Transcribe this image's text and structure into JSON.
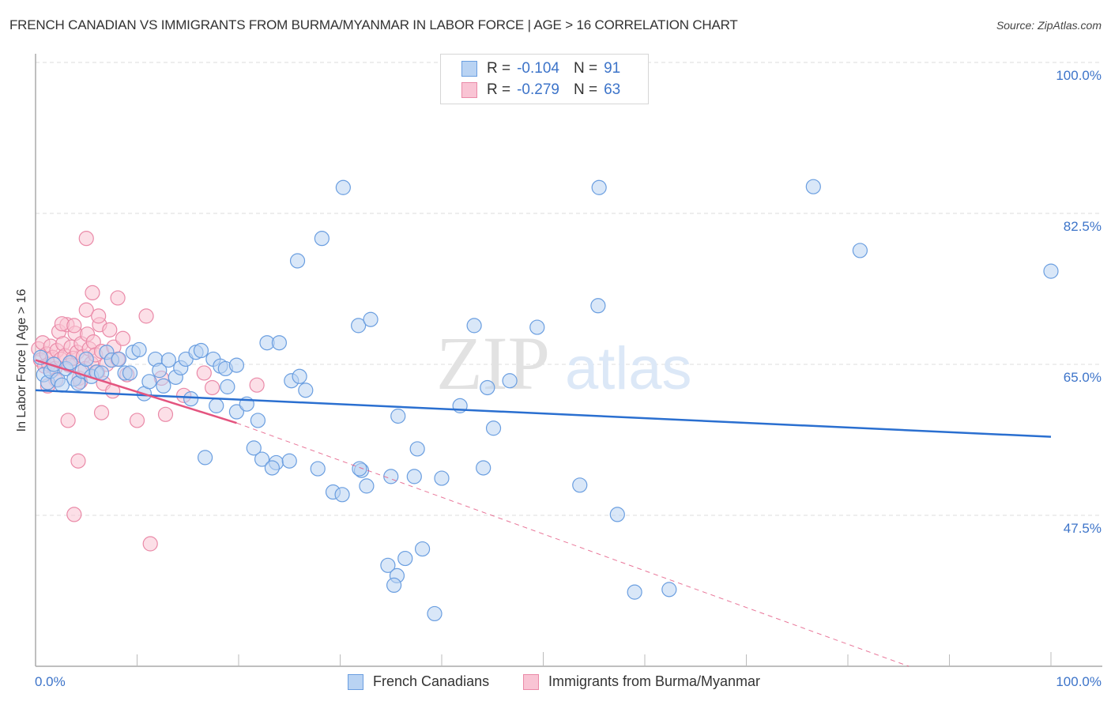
{
  "header": {
    "title": "FRENCH CANADIAN VS IMMIGRANTS FROM BURMA/MYANMAR IN LABOR FORCE | AGE > 16 CORRELATION CHART",
    "source": "Source: ZipAtlas.com"
  },
  "watermark": {
    "zip": "ZIP",
    "atlas": "atlas"
  },
  "legend": {
    "rows": [
      {
        "r_label": "R =",
        "r_value": "-0.104",
        "n_label": "N =",
        "n_value": "91"
      },
      {
        "r_label": "R =",
        "r_value": "-0.279",
        "n_label": "N =",
        "n_value": "63"
      }
    ]
  },
  "colors": {
    "blue_fill": "#b9d3f3",
    "blue_stroke": "#6a9ee0",
    "blue_line": "#2a6fd0",
    "pink_fill": "#f9c4d4",
    "pink_stroke": "#ea8aa8",
    "pink_line": "#e4547f",
    "tick_text": "#3d74c9",
    "grid": "#dddddd"
  },
  "chart_data": {
    "type": "scatter",
    "title": "FRENCH CANADIAN VS IMMIGRANTS FROM BURMA/MYANMAR IN LABOR FORCE | AGE > 16 CORRELATION CHART",
    "xlabel": "",
    "ylabel": "In Labor Force | Age > 16",
    "xlim": [
      0,
      100
    ],
    "ylim": [
      30,
      101.5
    ],
    "x_tick_labels": [
      "0.0%",
      "100.0%"
    ],
    "y_ticks": [
      100.0,
      82.5,
      65.0,
      47.5
    ],
    "y_tick_labels": [
      "100.0%",
      "82.5%",
      "65.0%",
      "47.5%"
    ],
    "grid": true,
    "legend_position": "top-center",
    "series": [
      {
        "name": "French Canadians",
        "R": -0.104,
        "N": 91,
        "trend": {
          "x": [
            0,
            100
          ],
          "y": [
            62.0,
            56.6
          ]
        },
        "points": [
          [
            0.5,
            65.8
          ],
          [
            0.8,
            63.8
          ],
          [
            1.2,
            62.9
          ],
          [
            1.5,
            64.2
          ],
          [
            1.8,
            65.0
          ],
          [
            2.2,
            63.2
          ],
          [
            2.6,
            62.6
          ],
          [
            3.0,
            64.5
          ],
          [
            3.4,
            65.2
          ],
          [
            3.8,
            63.3
          ],
          [
            4.2,
            62.8
          ],
          [
            4.6,
            64.2
          ],
          [
            5.0,
            65.6
          ],
          [
            5.5,
            63.6
          ],
          [
            6.0,
            64.1
          ],
          [
            6.5,
            64.0
          ],
          [
            7.0,
            66.4
          ],
          [
            7.5,
            65.5
          ],
          [
            8.2,
            65.6
          ],
          [
            8.8,
            64.0
          ],
          [
            9.3,
            64.0
          ],
          [
            9.6,
            66.4
          ],
          [
            10.2,
            66.7
          ],
          [
            10.7,
            61.6
          ],
          [
            11.2,
            63.0
          ],
          [
            11.8,
            65.6
          ],
          [
            12.2,
            64.3
          ],
          [
            12.6,
            62.5
          ],
          [
            13.1,
            65.5
          ],
          [
            13.8,
            63.5
          ],
          [
            14.3,
            64.6
          ],
          [
            14.8,
            65.6
          ],
          [
            15.3,
            61.0
          ],
          [
            15.8,
            66.4
          ],
          [
            16.3,
            66.6
          ],
          [
            17.5,
            65.6
          ],
          [
            18.2,
            64.8
          ],
          [
            18.7,
            64.5
          ],
          [
            18.9,
            62.4
          ],
          [
            19.8,
            64.9
          ],
          [
            17.8,
            60.2
          ],
          [
            19.8,
            59.5
          ],
          [
            20.8,
            60.4
          ],
          [
            21.9,
            58.5
          ],
          [
            16.7,
            54.2
          ],
          [
            21.5,
            55.3
          ],
          [
            22.3,
            54.0
          ],
          [
            23.7,
            53.6
          ],
          [
            23.3,
            53.0
          ],
          [
            25.0,
            53.8
          ],
          [
            22.8,
            67.5
          ],
          [
            24.0,
            67.5
          ],
          [
            25.2,
            63.1
          ],
          [
            26.0,
            63.6
          ],
          [
            26.6,
            62.0
          ],
          [
            25.8,
            77.0
          ],
          [
            28.2,
            79.6
          ],
          [
            30.3,
            85.5
          ],
          [
            31.8,
            69.5
          ],
          [
            33.0,
            70.2
          ],
          [
            27.8,
            52.9
          ],
          [
            29.3,
            50.2
          ],
          [
            30.2,
            49.9
          ],
          [
            32.1,
            52.7
          ],
          [
            31.9,
            52.9
          ],
          [
            32.6,
            50.9
          ],
          [
            35.0,
            52.0
          ],
          [
            37.3,
            52.0
          ],
          [
            40.0,
            51.8
          ],
          [
            37.6,
            55.2
          ],
          [
            35.7,
            59.0
          ],
          [
            44.1,
            53.0
          ],
          [
            45.1,
            57.6
          ],
          [
            44.5,
            62.3
          ],
          [
            46.7,
            63.1
          ],
          [
            41.8,
            60.2
          ],
          [
            43.2,
            69.5
          ],
          [
            49.4,
            69.3
          ],
          [
            53.6,
            51.0
          ],
          [
            55.4,
            71.8
          ],
          [
            55.5,
            85.5
          ],
          [
            34.7,
            41.7
          ],
          [
            35.6,
            40.5
          ],
          [
            38.1,
            43.6
          ],
          [
            36.4,
            42.5
          ],
          [
            35.3,
            39.4
          ],
          [
            57.3,
            47.6
          ],
          [
            59.0,
            38.6
          ],
          [
            62.4,
            38.9
          ],
          [
            39.3,
            36.1
          ],
          [
            76.6,
            85.6
          ],
          [
            81.2,
            78.2
          ],
          [
            100.0,
            75.8
          ]
        ]
      },
      {
        "name": "Immigrants from Burma/Myanmar",
        "R": -0.279,
        "N": 63,
        "trend": {
          "x": [
            0,
            19.8
          ],
          "y": [
            65.5,
            58.2
          ],
          "dashed_to": {
            "x": 86.0,
            "y": 30.0
          }
        },
        "points": [
          [
            0.3,
            66.8
          ],
          [
            0.5,
            65.5
          ],
          [
            0.7,
            67.5
          ],
          [
            0.9,
            64.8
          ],
          [
            1.1,
            66.2
          ],
          [
            1.3,
            65.0
          ],
          [
            1.5,
            67.1
          ],
          [
            1.7,
            65.8
          ],
          [
            1.9,
            64.5
          ],
          [
            2.1,
            66.6
          ],
          [
            2.3,
            68.8
          ],
          [
            2.5,
            65.6
          ],
          [
            2.7,
            67.4
          ],
          [
            2.9,
            66.0
          ],
          [
            3.1,
            69.6
          ],
          [
            3.3,
            64.9
          ],
          [
            3.5,
            67.0
          ],
          [
            3.7,
            65.7
          ],
          [
            3.9,
            68.6
          ],
          [
            4.1,
            66.4
          ],
          [
            4.3,
            63.4
          ],
          [
            4.5,
            67.4
          ],
          [
            4.7,
            65.9
          ],
          [
            4.9,
            64.5
          ],
          [
            5.1,
            68.5
          ],
          [
            5.3,
            66.8
          ],
          [
            5.5,
            65.1
          ],
          [
            5.7,
            67.6
          ],
          [
            5.9,
            66.1
          ],
          [
            6.1,
            64.1
          ],
          [
            6.3,
            69.6
          ],
          [
            6.5,
            66.5
          ],
          [
            6.7,
            62.8
          ],
          [
            7.0,
            65.0
          ],
          [
            7.3,
            69.0
          ],
          [
            7.7,
            67.0
          ],
          [
            8.1,
            65.6
          ],
          [
            2.6,
            69.7
          ],
          [
            3.8,
            69.5
          ],
          [
            4.4,
            63.0
          ],
          [
            5.0,
            71.3
          ],
          [
            5.6,
            73.3
          ],
          [
            6.2,
            70.6
          ],
          [
            8.1,
            72.7
          ],
          [
            8.6,
            68.0
          ],
          [
            9.0,
            63.8
          ],
          [
            10.9,
            70.6
          ],
          [
            12.4,
            63.4
          ],
          [
            14.6,
            61.4
          ],
          [
            17.4,
            62.3
          ],
          [
            21.8,
            62.6
          ],
          [
            3.2,
            58.5
          ],
          [
            6.5,
            59.4
          ],
          [
            10.0,
            58.5
          ],
          [
            12.8,
            59.2
          ],
          [
            16.6,
            64.0
          ],
          [
            4.2,
            53.8
          ],
          [
            3.8,
            47.6
          ],
          [
            11.3,
            44.2
          ],
          [
            5.0,
            79.6
          ],
          [
            2.0,
            63.2
          ],
          [
            1.2,
            62.5
          ],
          [
            7.6,
            61.9
          ]
        ]
      }
    ]
  },
  "bottom_legend": {
    "items": [
      {
        "label": "French Canadians"
      },
      {
        "label": "Immigrants from Burma/Myanmar"
      }
    ]
  }
}
